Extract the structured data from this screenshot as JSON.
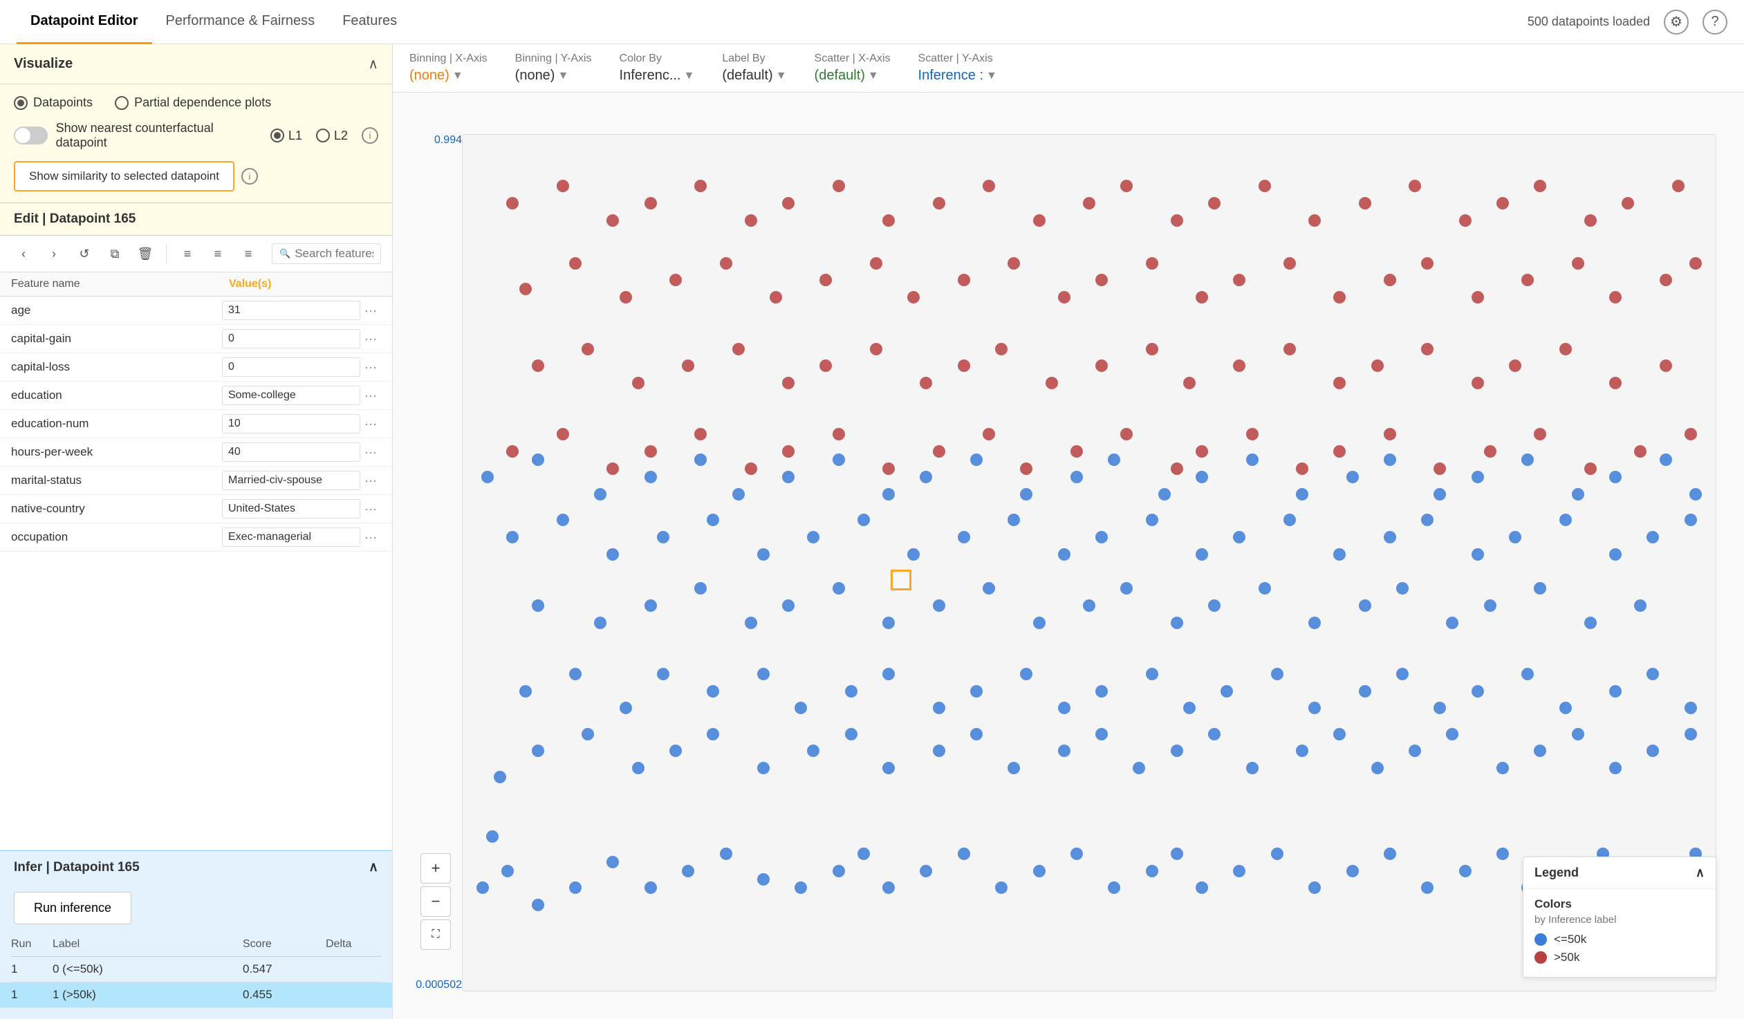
{
  "nav": {
    "tabs": [
      {
        "id": "datapoint-editor",
        "label": "Datapoint Editor",
        "active": true
      },
      {
        "id": "performance-fairness",
        "label": "Performance & Fairness",
        "active": false
      },
      {
        "id": "features",
        "label": "Features",
        "active": false
      }
    ],
    "datapoints_loaded": "500 datapoints loaded"
  },
  "visualize": {
    "title": "Visualize",
    "radio_options": [
      {
        "id": "datapoints",
        "label": "Datapoints",
        "selected": true
      },
      {
        "id": "partial-dependence",
        "label": "Partial dependence plots",
        "selected": false
      }
    ],
    "toggle": {
      "label": "Show nearest counterfactual datapoint",
      "on": false
    },
    "l_options": [
      {
        "id": "l1",
        "label": "L1",
        "selected": true
      },
      {
        "id": "l2",
        "label": "L2",
        "selected": false
      }
    ],
    "similarity_btn": "Show similarity to selected datapoint"
  },
  "edit": {
    "title": "Edit | Datapoint 165",
    "search_placeholder": "Search features",
    "table_headers": {
      "feature_name": "Feature name",
      "values": "Value(s)"
    },
    "features": [
      {
        "name": "age",
        "value": "31",
        "type": "text"
      },
      {
        "name": "capital-gain",
        "value": "0",
        "type": "text"
      },
      {
        "name": "capital-loss",
        "value": "0",
        "type": "text"
      },
      {
        "name": "education",
        "value": "Some-college",
        "type": "text"
      },
      {
        "name": "education-num",
        "value": "10",
        "type": "text"
      },
      {
        "name": "hours-per-week",
        "value": "40",
        "type": "text"
      },
      {
        "name": "marital-status",
        "value": "Married-civ-spouse",
        "type": "text"
      },
      {
        "name": "native-country",
        "value": "United-States",
        "type": "text"
      },
      {
        "name": "occupation",
        "value": "Exec-managerial",
        "type": "text"
      }
    ]
  },
  "infer": {
    "title": "Infer | Datapoint 165",
    "run_btn": "Run inference",
    "table_headers": {
      "run": "Run",
      "label": "Label",
      "score": "Score",
      "delta": "Delta"
    },
    "rows": [
      {
        "run": "1",
        "label": "0 (<=50k)",
        "score": "0.547",
        "delta": "",
        "highlighted": false
      },
      {
        "run": "1",
        "label": "1 (>50k)",
        "score": "0.455",
        "delta": "",
        "highlighted": true
      }
    ]
  },
  "controls": {
    "binning_x": {
      "label": "Binning | X-Axis",
      "value": "(none)",
      "color": "orange"
    },
    "binning_y": {
      "label": "Binning | Y-Axis",
      "value": "(none)",
      "color": "black"
    },
    "color_by": {
      "label": "Color By",
      "value": "Inferenc...",
      "color": "black"
    },
    "label_by": {
      "label": "Label By",
      "value": "(default)",
      "color": "black"
    },
    "scatter_x": {
      "label": "Scatter | X-Axis",
      "value": "(default)",
      "color": "green"
    },
    "scatter_y": {
      "label": "Scatter | Y-Axis",
      "value": "Inference :",
      "color": "blue"
    }
  },
  "viz": {
    "y_labels": [
      "0.994",
      "0.000502"
    ],
    "zoom_plus": "+",
    "zoom_minus": "−",
    "zoom_fullscreen": "⛶"
  },
  "legend": {
    "title": "Legend",
    "colors_title": "Colors",
    "colors_subtitle": "by Inference label",
    "items": [
      {
        "label": "<=50k",
        "color": "#3b7dd8"
      },
      {
        "label": ">50k",
        "color": "#b94040"
      }
    ]
  },
  "dots": {
    "blue_positions": [
      [
        12,
        82
      ],
      [
        8,
        88
      ],
      [
        18,
        86
      ],
      [
        30,
        90
      ],
      [
        45,
        88
      ],
      [
        60,
        85
      ],
      [
        75,
        88
      ],
      [
        90,
        86
      ],
      [
        105,
        84
      ],
      [
        120,
        87
      ],
      [
        135,
        88
      ],
      [
        150,
        86
      ],
      [
        160,
        84
      ],
      [
        170,
        88
      ],
      [
        185,
        86
      ],
      [
        200,
        84
      ],
      [
        215,
        88
      ],
      [
        230,
        86
      ],
      [
        245,
        84
      ],
      [
        260,
        88
      ],
      [
        275,
        86
      ],
      [
        285,
        84
      ],
      [
        295,
        88
      ],
      [
        310,
        86
      ],
      [
        325,
        84
      ],
      [
        340,
        88
      ],
      [
        355,
        86
      ],
      [
        370,
        84
      ],
      [
        385,
        88
      ],
      [
        400,
        86
      ],
      [
        415,
        84
      ],
      [
        425,
        88
      ],
      [
        440,
        86
      ],
      [
        455,
        84
      ],
      [
        465,
        88
      ],
      [
        480,
        86
      ],
      [
        492,
        84
      ],
      [
        15,
        75
      ],
      [
        30,
        72
      ],
      [
        50,
        70
      ],
      [
        70,
        74
      ],
      [
        85,
        72
      ],
      [
        100,
        70
      ],
      [
        120,
        74
      ],
      [
        140,
        72
      ],
      [
        155,
        70
      ],
      [
        170,
        74
      ],
      [
        190,
        72
      ],
      [
        205,
        70
      ],
      [
        220,
        74
      ],
      [
        240,
        72
      ],
      [
        255,
        70
      ],
      [
        270,
        74
      ],
      [
        285,
        72
      ],
      [
        300,
        70
      ],
      [
        315,
        74
      ],
      [
        335,
        72
      ],
      [
        350,
        70
      ],
      [
        365,
        74
      ],
      [
        380,
        72
      ],
      [
        395,
        70
      ],
      [
        415,
        74
      ],
      [
        430,
        72
      ],
      [
        445,
        70
      ],
      [
        460,
        74
      ],
      [
        475,
        72
      ],
      [
        490,
        70
      ],
      [
        25,
        65
      ],
      [
        45,
        63
      ],
      [
        65,
        67
      ],
      [
        80,
        63
      ],
      [
        100,
        65
      ],
      [
        120,
        63
      ],
      [
        135,
        67
      ],
      [
        155,
        65
      ],
      [
        170,
        63
      ],
      [
        190,
        67
      ],
      [
        205,
        65
      ],
      [
        225,
        63
      ],
      [
        240,
        67
      ],
      [
        255,
        65
      ],
      [
        275,
        63
      ],
      [
        290,
        67
      ],
      [
        305,
        65
      ],
      [
        325,
        63
      ],
      [
        340,
        67
      ],
      [
        360,
        65
      ],
      [
        375,
        63
      ],
      [
        390,
        67
      ],
      [
        405,
        65
      ],
      [
        425,
        63
      ],
      [
        440,
        67
      ],
      [
        460,
        65
      ],
      [
        475,
        63
      ],
      [
        490,
        67
      ],
      [
        30,
        55
      ],
      [
        55,
        57
      ],
      [
        75,
        55
      ],
      [
        95,
        53
      ],
      [
        115,
        57
      ],
      [
        130,
        55
      ],
      [
        150,
        53
      ],
      [
        170,
        57
      ],
      [
        190,
        55
      ],
      [
        210,
        53
      ],
      [
        230,
        57
      ],
      [
        250,
        55
      ],
      [
        265,
        53
      ],
      [
        285,
        57
      ],
      [
        300,
        55
      ],
      [
        320,
        53
      ],
      [
        340,
        57
      ],
      [
        360,
        55
      ],
      [
        375,
        53
      ],
      [
        395,
        57
      ],
      [
        410,
        55
      ],
      [
        430,
        53
      ],
      [
        450,
        57
      ],
      [
        470,
        55
      ],
      [
        20,
        47
      ],
      [
        40,
        45
      ],
      [
        60,
        49
      ],
      [
        80,
        47
      ],
      [
        100,
        45
      ],
      [
        120,
        49
      ],
      [
        140,
        47
      ],
      [
        160,
        45
      ],
      [
        180,
        49
      ],
      [
        200,
        47
      ],
      [
        220,
        45
      ],
      [
        240,
        49
      ],
      [
        255,
        47
      ],
      [
        275,
        45
      ],
      [
        295,
        49
      ],
      [
        310,
        47
      ],
      [
        330,
        45
      ],
      [
        350,
        49
      ],
      [
        370,
        47
      ],
      [
        385,
        45
      ],
      [
        405,
        49
      ],
      [
        420,
        47
      ],
      [
        440,
        45
      ],
      [
        460,
        49
      ],
      [
        475,
        47
      ],
      [
        490,
        45
      ],
      [
        10,
        40
      ],
      [
        30,
        38
      ],
      [
        55,
        42
      ],
      [
        75,
        40
      ],
      [
        95,
        38
      ],
      [
        110,
        42
      ],
      [
        130,
        40
      ],
      [
        150,
        38
      ],
      [
        170,
        42
      ],
      [
        185,
        40
      ],
      [
        205,
        38
      ],
      [
        225,
        42
      ],
      [
        245,
        40
      ],
      [
        260,
        38
      ],
      [
        280,
        42
      ],
      [
        295,
        40
      ],
      [
        315,
        38
      ],
      [
        335,
        42
      ],
      [
        355,
        40
      ],
      [
        370,
        38
      ],
      [
        390,
        42
      ],
      [
        405,
        40
      ],
      [
        425,
        38
      ],
      [
        445,
        42
      ],
      [
        460,
        40
      ],
      [
        480,
        38
      ],
      [
        492,
        42
      ]
    ],
    "red_positions": [
      [
        20,
        8
      ],
      [
        40,
        6
      ],
      [
        60,
        10
      ],
      [
        75,
        8
      ],
      [
        95,
        6
      ],
      [
        115,
        10
      ],
      [
        130,
        8
      ],
      [
        150,
        6
      ],
      [
        170,
        10
      ],
      [
        190,
        8
      ],
      [
        210,
        6
      ],
      [
        230,
        10
      ],
      [
        250,
        8
      ],
      [
        265,
        6
      ],
      [
        285,
        10
      ],
      [
        300,
        8
      ],
      [
        320,
        6
      ],
      [
        340,
        10
      ],
      [
        360,
        8
      ],
      [
        380,
        6
      ],
      [
        400,
        10
      ],
      [
        415,
        8
      ],
      [
        430,
        6
      ],
      [
        450,
        10
      ],
      [
        465,
        8
      ],
      [
        485,
        6
      ],
      [
        25,
        18
      ],
      [
        45,
        15
      ],
      [
        65,
        19
      ],
      [
        85,
        17
      ],
      [
        105,
        15
      ],
      [
        125,
        19
      ],
      [
        145,
        17
      ],
      [
        165,
        15
      ],
      [
        180,
        19
      ],
      [
        200,
        17
      ],
      [
        220,
        15
      ],
      [
        240,
        19
      ],
      [
        255,
        17
      ],
      [
        275,
        15
      ],
      [
        295,
        19
      ],
      [
        310,
        17
      ],
      [
        330,
        15
      ],
      [
        350,
        19
      ],
      [
        370,
        17
      ],
      [
        385,
        15
      ],
      [
        405,
        19
      ],
      [
        425,
        17
      ],
      [
        445,
        15
      ],
      [
        460,
        19
      ],
      [
        480,
        17
      ],
      [
        492,
        15
      ],
      [
        30,
        27
      ],
      [
        50,
        25
      ],
      [
        70,
        29
      ],
      [
        90,
        27
      ],
      [
        110,
        25
      ],
      [
        130,
        29
      ],
      [
        145,
        27
      ],
      [
        165,
        25
      ],
      [
        185,
        29
      ],
      [
        200,
        27
      ],
      [
        215,
        25
      ],
      [
        235,
        29
      ],
      [
        255,
        27
      ],
      [
        275,
        25
      ],
      [
        290,
        29
      ],
      [
        310,
        27
      ],
      [
        330,
        25
      ],
      [
        350,
        29
      ],
      [
        365,
        27
      ],
      [
        385,
        25
      ],
      [
        405,
        29
      ],
      [
        420,
        27
      ],
      [
        440,
        25
      ],
      [
        460,
        29
      ],
      [
        480,
        27
      ],
      [
        20,
        37
      ],
      [
        40,
        35
      ],
      [
        60,
        39
      ],
      [
        75,
        37
      ],
      [
        95,
        35
      ],
      [
        115,
        39
      ],
      [
        130,
        37
      ],
      [
        150,
        35
      ],
      [
        170,
        39
      ],
      [
        190,
        37
      ],
      [
        210,
        35
      ],
      [
        225,
        39
      ],
      [
        245,
        37
      ],
      [
        265,
        35
      ],
      [
        285,
        39
      ],
      [
        295,
        37
      ],
      [
        315,
        35
      ],
      [
        335,
        39
      ],
      [
        350,
        37
      ],
      [
        370,
        35
      ],
      [
        390,
        39
      ],
      [
        410,
        37
      ],
      [
        430,
        35
      ],
      [
        450,
        39
      ],
      [
        470,
        37
      ],
      [
        490,
        35
      ]
    ]
  }
}
